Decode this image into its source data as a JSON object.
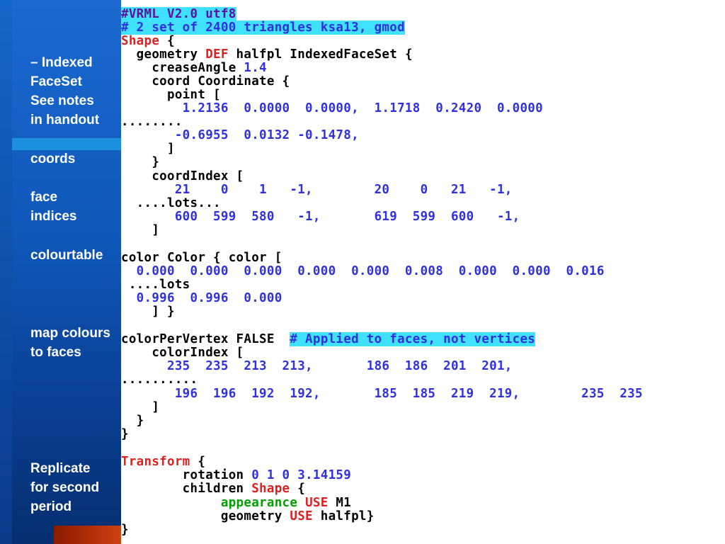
{
  "sidebar": {
    "notes": [
      "– Indexed\nFaceSet\nSee notes\nin handout",
      "coords",
      "face\nindices",
      "colourtable",
      "map colours\nto faces",
      "Replicate\nfor second\nperiod"
    ]
  },
  "code": {
    "header1": "#VRML V2.0 utf8",
    "header2": "# 2 set of 2400 triangles ksa13, gmod",
    "shape_kw": "Shape",
    "brace": " {",
    "geometry_pre": "  geometry ",
    "def_kw": "DEF",
    "geometry_post": " halfpl IndexedFaceSet {",
    "crease_pre": "    creaseAngle ",
    "crease_val": "1.4",
    "coord_line": "    coord Coordinate {",
    "point_line": "      point [",
    "points_row1": "        1.2136  0.0000  0.0000,  1.1718  0.2420  0.0000",
    "dots1": "........",
    "points_row2": "       -0.6955  0.0132 -0.1478,",
    "close_bracket1": "      ]",
    "close_brace1": "    }",
    "coordindex_line": "    coordIndex [",
    "ci_row1": "       21    0    1   -1,        20    0   21   -1,",
    "lots1": "  ....lots...",
    "ci_row2": "       600  599  580   -1,       619  599  600   -1,",
    "close_bracket2": "    ]",
    "color_line": "color Color { color [",
    "color_row1": "  0.000  0.000  0.000  0.000  0.000  0.008  0.000  0.000  0.016",
    "lots2": " ....lots",
    "color_row2": "  0.996  0.996  0.000",
    "close_color": "    ] }",
    "cpv_pre": "colorPerVertex FALSE  ",
    "cpv_comment": "# Applied to faces, not vertices",
    "colorindex_line": "    colorIndex [",
    "cidx_row1": "      235  235  213  213,       186  186  201  201,",
    "dots2": "..........",
    "cidx_row2": "       196  196  192  192,       185  185  219  219,        235  235",
    "close_bracket3": "    ]",
    "close_brace2": "  }",
    "close_brace3": "}",
    "transform_kw": "Transform",
    "rotation_pre": "        rotation ",
    "rotation_val": "0 1 0 3.14159",
    "children_pre": "        children ",
    "children_post": " {",
    "appearance_kw": "appearance",
    "use_kw": "USE",
    "m1": " M1",
    "geometry2_pre": "             geometry ",
    "geometry2_post": " halfpl}",
    "close_final": "}"
  },
  "colors": {
    "sidebar": "#0f56b8",
    "number": "#3030e0",
    "keyword": "#e02020",
    "comment_bg": "#40e0ff",
    "green": "#00a000"
  }
}
